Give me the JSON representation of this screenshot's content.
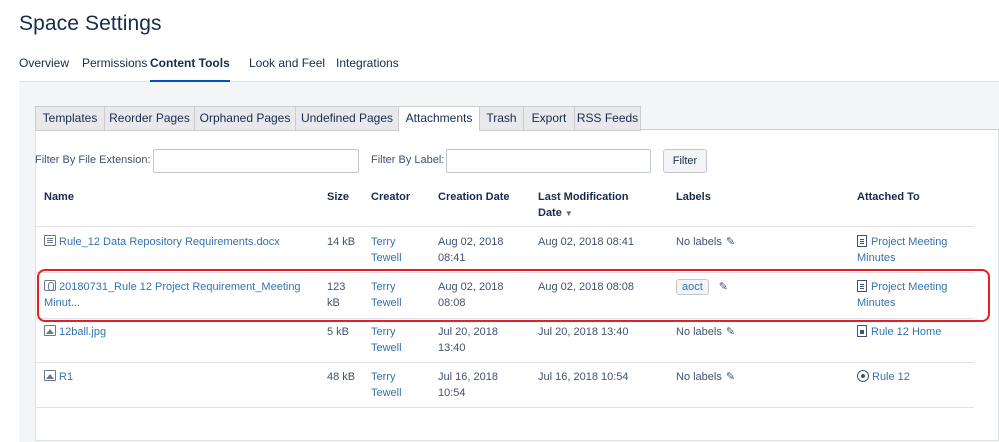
{
  "page": {
    "title": "Space Settings"
  },
  "top_tabs": [
    {
      "label": "Overview",
      "active": false
    },
    {
      "label": "Permissions",
      "active": false
    },
    {
      "label": "Content Tools",
      "active": true
    },
    {
      "label": "Look and Feel",
      "active": false
    },
    {
      "label": "Integrations",
      "active": false
    }
  ],
  "sub_tabs": [
    {
      "label": "Templates",
      "active": false
    },
    {
      "label": "Reorder Pages",
      "active": false
    },
    {
      "label": "Orphaned Pages",
      "active": false
    },
    {
      "label": "Undefined Pages",
      "active": false
    },
    {
      "label": "Attachments",
      "active": true
    },
    {
      "label": "Trash",
      "active": false
    },
    {
      "label": "Export",
      "active": false
    },
    {
      "label": "RSS Feeds",
      "active": false
    }
  ],
  "filters": {
    "extension_label": "Filter By File Extension:",
    "extension_value": "",
    "label_label": "Filter By Label:",
    "label_value": "",
    "button_label": "Filter"
  },
  "table": {
    "headers": {
      "name": "Name",
      "size": "Size",
      "creator": "Creator",
      "creation_date": "Creation Date",
      "modified_line1": "Last Modification",
      "modified_line2": "Date",
      "labels": "Labels",
      "attached_to": "Attached To"
    },
    "rows": [
      {
        "icon": "document-icon",
        "name_line1": "Rule_12 Data Repository Requirements.docx",
        "name_line2": "",
        "size_line1": "14 kB",
        "size_line2": "",
        "creator_line1": "Terry",
        "creator_line2": "Tewell",
        "created_line1": "Aug 02, 2018",
        "created_line2": "08:41",
        "modified": "Aug 02, 2018 08:41",
        "labels": "No labels",
        "attached_icon": "page-icon",
        "attached_line1": "Project Meeting",
        "attached_line2": "Minutes"
      },
      {
        "icon": "pdf-icon",
        "name_line1": "20180731_Rule 12 Project Requirement_Meeting",
        "name_line2": "Minut...",
        "size_line1": "123",
        "size_line2": "kB",
        "creator_line1": "Terry",
        "creator_line2": "Tewell",
        "created_line1": "Aug 02, 2018",
        "created_line2": "08:08",
        "modified": "Aug 02, 2018 08:08",
        "labels": "aoct",
        "attached_icon": "page-icon",
        "attached_line1": "Project Meeting",
        "attached_line2": "Minutes"
      },
      {
        "icon": "image-icon",
        "name_line1": "12ball.jpg",
        "name_line2": "",
        "size_line1": "5 kB",
        "size_line2": "",
        "creator_line1": "Terry",
        "creator_line2": "Tewell",
        "created_line1": "Jul 20, 2018",
        "created_line2": "13:40",
        "modified": "Jul 20, 2018 13:40",
        "labels": "No labels",
        "attached_icon": "home-page-icon",
        "attached_line1": "Rule 12 Home",
        "attached_line2": ""
      },
      {
        "icon": "image-icon",
        "name_line1": "R1",
        "name_line2": "",
        "size_line1": "48 kB",
        "size_line2": "",
        "creator_line1": "Terry",
        "creator_line2": "Tewell",
        "created_line1": "Jul 16, 2018",
        "created_line2": "10:54",
        "modified": "Jul 16, 2018 10:54",
        "labels": "No labels",
        "attached_icon": "space-icon",
        "attached_line1": "Rule 12",
        "attached_line2": ""
      }
    ]
  },
  "colors": {
    "link": "#3572b0",
    "highlight": "#e32027",
    "active_tab_underline": "#0052cc"
  }
}
